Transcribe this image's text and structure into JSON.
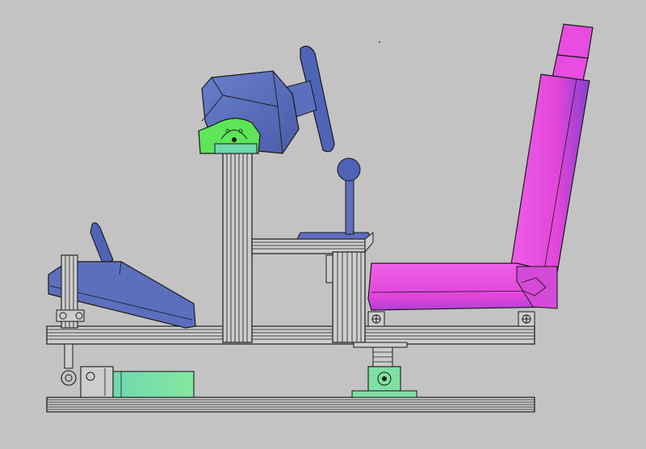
{
  "canvas": {
    "background": "#c3c3c3",
    "line_color": "#1a1a1a"
  },
  "colors": {
    "frame_extrusion": "#c8c8c8",
    "blue_part": "#5b6fbd",
    "blue_part_dark": "#3f4f9a",
    "green_part": "#7fe0a3",
    "green_part_bright": "#5ee55a",
    "magenta_seat": "#e84ce0",
    "magenta_seat_dark": "#b43ccc",
    "purple_highlight": "#7a4fd6"
  },
  "components": [
    "base-rail",
    "upper-frame-rail",
    "steering-column-post",
    "steering-wheel",
    "steering-motor-housing",
    "steering-mount-bracket",
    "shifter-knob",
    "shifter-stick",
    "shifter-platform",
    "shifter-post",
    "seat-backrest",
    "seat-headrest",
    "seat-cushion",
    "pedal-box",
    "pedal-arm",
    "pedal-post",
    "linear-actuator-left",
    "actuator-rod-end",
    "linear-actuator-center",
    "actuator-center-clevis"
  ]
}
